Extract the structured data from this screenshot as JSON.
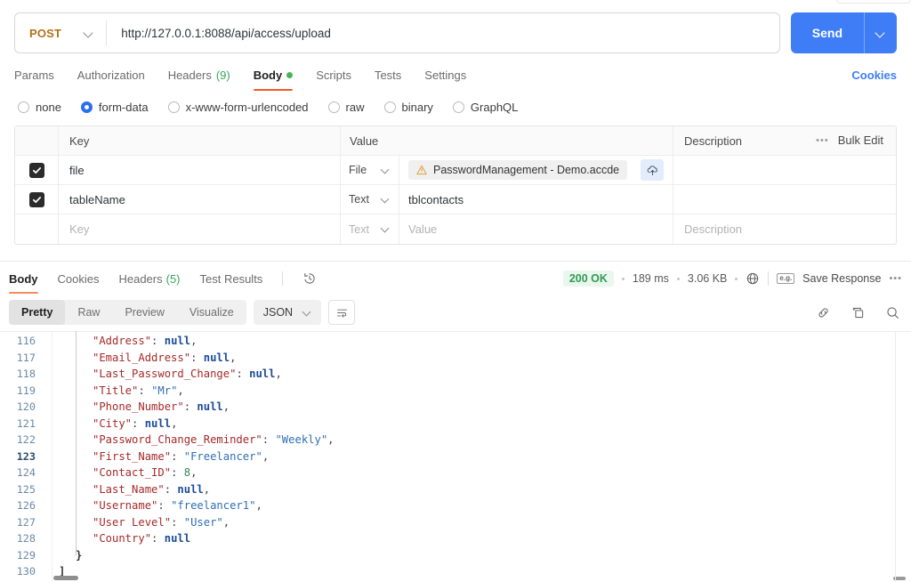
{
  "request": {
    "method": "POST",
    "url": "http://127.0.0.1:8088/api/access/upload",
    "send_label": "Send",
    "cookies_label": "Cookies",
    "tabs": [
      {
        "label": "Params",
        "active": false
      },
      {
        "label": "Authorization",
        "active": false
      },
      {
        "label": "Headers",
        "count": "(9)",
        "active": false
      },
      {
        "label": "Body",
        "active": true,
        "dot": true
      },
      {
        "label": "Scripts",
        "active": false
      },
      {
        "label": "Tests",
        "active": false
      },
      {
        "label": "Settings",
        "active": false
      }
    ],
    "body_types": [
      {
        "label": "none",
        "selected": false
      },
      {
        "label": "form-data",
        "selected": true
      },
      {
        "label": "x-www-form-urlencoded",
        "selected": false
      },
      {
        "label": "raw",
        "selected": false
      },
      {
        "label": "binary",
        "selected": false
      },
      {
        "label": "GraphQL",
        "selected": false
      }
    ],
    "table": {
      "headers": {
        "key": "Key",
        "value": "Value",
        "description": "Description"
      },
      "bulk_edit_label": "Bulk Edit",
      "bulk_dots": "•••",
      "rows": [
        {
          "checked": true,
          "key": "file",
          "type": "File",
          "value": "PasswordManagement - Demo.accde",
          "value_is_file_chip": true,
          "has_warning": true,
          "has_upload_button": true,
          "description": ""
        },
        {
          "checked": true,
          "key": "tableName",
          "type": "Text",
          "value": "tblcontacts",
          "value_is_file_chip": false,
          "has_warning": false,
          "has_upload_button": false,
          "description": ""
        },
        {
          "checked": false,
          "key": "Key",
          "key_placeholder": true,
          "type": "Text",
          "type_placeholder": true,
          "value": "Value",
          "value_placeholder": true,
          "value_is_file_chip": false,
          "has_warning": false,
          "has_upload_button": false,
          "description": "Description",
          "description_placeholder": true
        }
      ]
    }
  },
  "response": {
    "tabs": [
      {
        "label": "Body",
        "active": true
      },
      {
        "label": "Cookies",
        "active": false
      },
      {
        "label": "Headers",
        "count": "(5)",
        "active": false
      },
      {
        "label": "Test Results",
        "active": false
      }
    ],
    "status": "200 OK",
    "time": "189 ms",
    "size": "3.06 KB",
    "save_response_label": "Save Response",
    "save_response_icon_text": "e.g.",
    "more_dots": "•••",
    "view_modes": [
      {
        "label": "Pretty",
        "active": true
      },
      {
        "label": "Raw",
        "active": false
      },
      {
        "label": "Preview",
        "active": false
      },
      {
        "label": "Visualize",
        "active": false
      }
    ],
    "format": "JSON"
  },
  "colors": {
    "accent_blue": "#3f7df7",
    "method_post": "#b07219",
    "tab_underline": "#ef5b25",
    "status_green": "#2e9c52",
    "link_blue": "#3f7df7"
  },
  "code": {
    "lines": [
      {
        "num": "116",
        "current": false,
        "indent": 4,
        "tokens": [
          {
            "t": "k",
            "v": "\"Address\""
          },
          {
            "t": "p",
            "v": ": "
          },
          {
            "t": "nul",
            "v": "null"
          },
          {
            "t": "p",
            "v": ","
          }
        ]
      },
      {
        "num": "117",
        "current": false,
        "indent": 4,
        "tokens": [
          {
            "t": "k",
            "v": "\"Email_Address\""
          },
          {
            "t": "p",
            "v": ": "
          },
          {
            "t": "nul",
            "v": "null"
          },
          {
            "t": "p",
            "v": ","
          }
        ]
      },
      {
        "num": "118",
        "current": false,
        "indent": 4,
        "tokens": [
          {
            "t": "k",
            "v": "\"Last_Password_Change\""
          },
          {
            "t": "p",
            "v": ": "
          },
          {
            "t": "nul",
            "v": "null"
          },
          {
            "t": "p",
            "v": ","
          }
        ]
      },
      {
        "num": "119",
        "current": false,
        "indent": 4,
        "tokens": [
          {
            "t": "k",
            "v": "\"Title\""
          },
          {
            "t": "p",
            "v": ": "
          },
          {
            "t": "s",
            "v": "\"Mr\""
          },
          {
            "t": "p",
            "v": ","
          }
        ]
      },
      {
        "num": "120",
        "current": false,
        "indent": 4,
        "tokens": [
          {
            "t": "k",
            "v": "\"Phone_Number\""
          },
          {
            "t": "p",
            "v": ": "
          },
          {
            "t": "nul",
            "v": "null"
          },
          {
            "t": "p",
            "v": ","
          }
        ]
      },
      {
        "num": "121",
        "current": false,
        "indent": 4,
        "tokens": [
          {
            "t": "k",
            "v": "\"City\""
          },
          {
            "t": "p",
            "v": ": "
          },
          {
            "t": "nul",
            "v": "null"
          },
          {
            "t": "p",
            "v": ","
          }
        ]
      },
      {
        "num": "122",
        "current": false,
        "indent": 4,
        "tokens": [
          {
            "t": "k",
            "v": "\"Password_Change_Reminder\""
          },
          {
            "t": "p",
            "v": ": "
          },
          {
            "t": "s",
            "v": "\"Weekly\""
          },
          {
            "t": "p",
            "v": ","
          }
        ]
      },
      {
        "num": "123",
        "current": true,
        "indent": 4,
        "tokens": [
          {
            "t": "k",
            "v": "\"First_Name\""
          },
          {
            "t": "p",
            "v": ": "
          },
          {
            "t": "s",
            "v": "\"Freelancer\""
          },
          {
            "t": "p",
            "v": ","
          }
        ]
      },
      {
        "num": "124",
        "current": false,
        "indent": 4,
        "tokens": [
          {
            "t": "k",
            "v": "\"Contact_ID\""
          },
          {
            "t": "p",
            "v": ": "
          },
          {
            "t": "num",
            "v": "8"
          },
          {
            "t": "p",
            "v": ","
          }
        ]
      },
      {
        "num": "125",
        "current": false,
        "indent": 4,
        "tokens": [
          {
            "t": "k",
            "v": "\"Last_Name\""
          },
          {
            "t": "p",
            "v": ": "
          },
          {
            "t": "nul",
            "v": "null"
          },
          {
            "t": "p",
            "v": ","
          }
        ]
      },
      {
        "num": "126",
        "current": false,
        "indent": 4,
        "tokens": [
          {
            "t": "k",
            "v": "\"Username\""
          },
          {
            "t": "p",
            "v": ": "
          },
          {
            "t": "s",
            "v": "\"freelancer1\""
          },
          {
            "t": "p",
            "v": ","
          }
        ]
      },
      {
        "num": "127",
        "current": false,
        "indent": 4,
        "tokens": [
          {
            "t": "k",
            "v": "\"User Level\""
          },
          {
            "t": "p",
            "v": ": "
          },
          {
            "t": "s",
            "v": "\"User\""
          },
          {
            "t": "p",
            "v": ","
          }
        ]
      },
      {
        "num": "128",
        "current": false,
        "indent": 4,
        "tokens": [
          {
            "t": "k",
            "v": "\"Country\""
          },
          {
            "t": "p",
            "v": ": "
          },
          {
            "t": "nul",
            "v": "null"
          }
        ]
      },
      {
        "num": "129",
        "current": false,
        "indent": 2,
        "tokens": [
          {
            "t": "brace",
            "v": "}"
          }
        ]
      },
      {
        "num": "130",
        "current": false,
        "indent": 0,
        "tokens": [
          {
            "t": "brace",
            "v": "]"
          }
        ]
      }
    ]
  }
}
